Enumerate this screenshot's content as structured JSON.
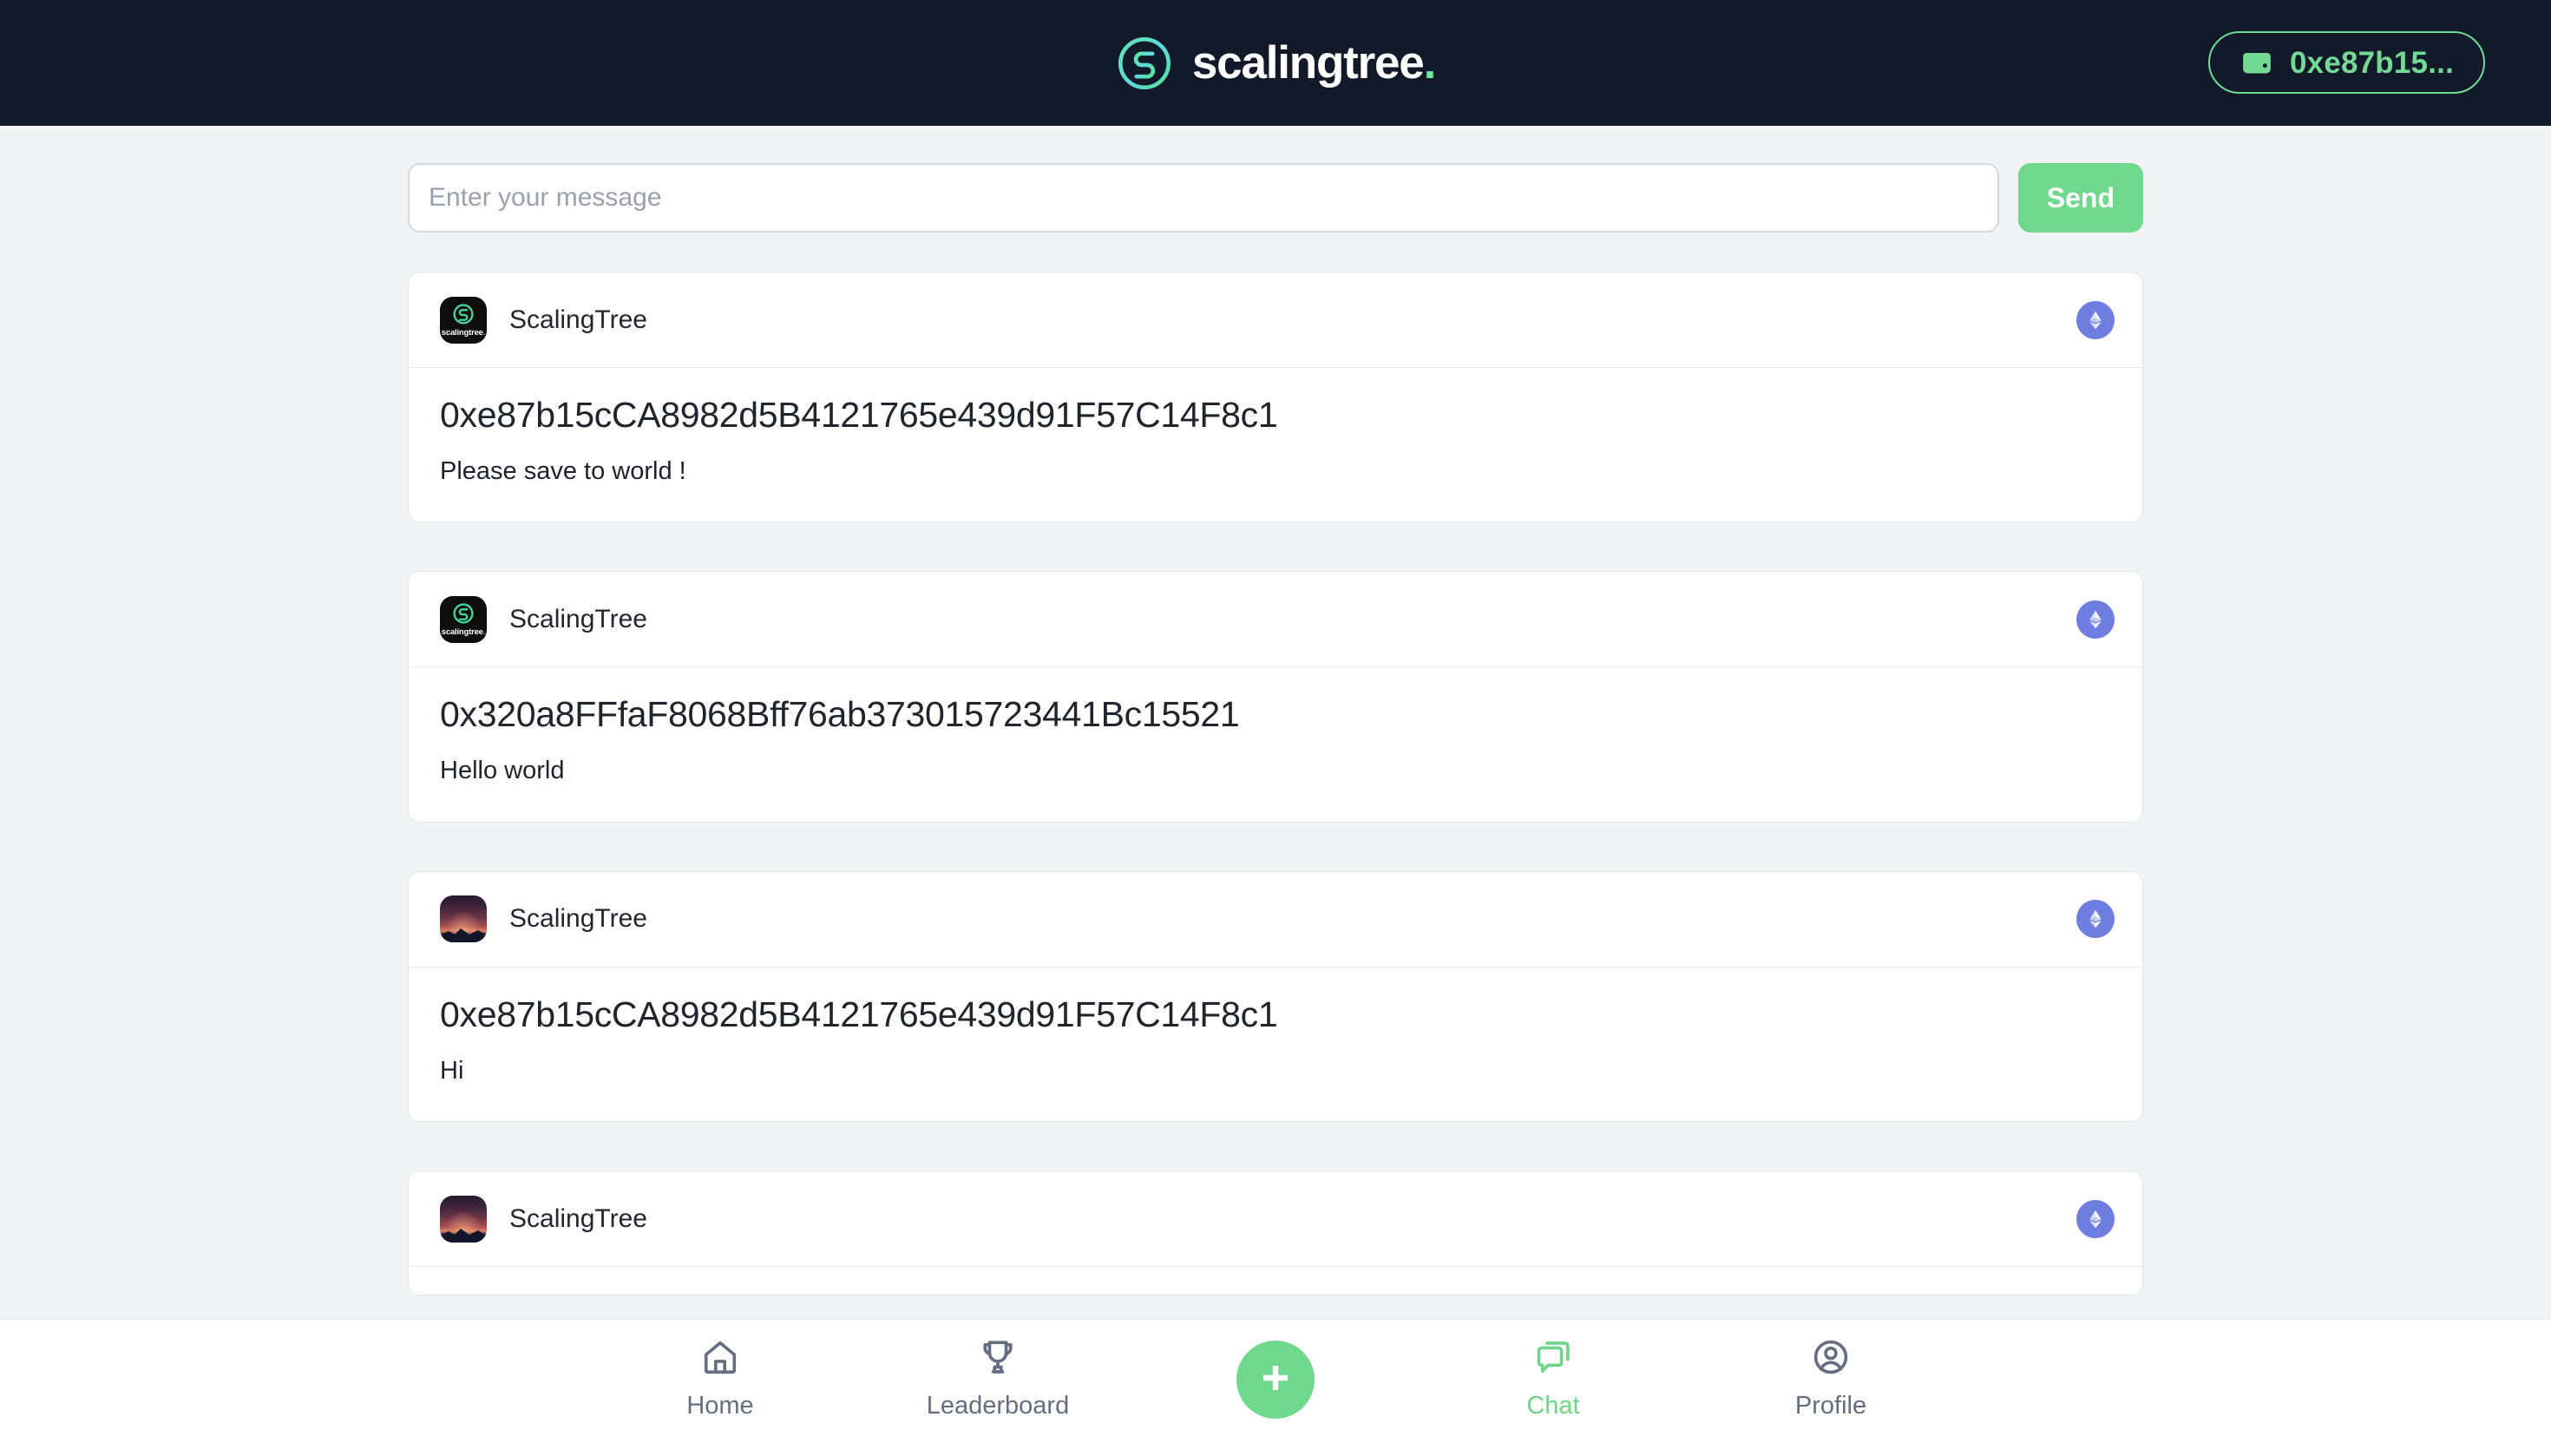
{
  "header": {
    "brand_name": "scalingtree",
    "brand_dot": ".",
    "logo_icon": "scalingtree-s-logo-icon",
    "wallet": {
      "icon": "wallet-icon",
      "label": "0xe87b15...",
      "accent": "#74d994"
    },
    "background": "#121a29"
  },
  "composer": {
    "input_value": "",
    "input_placeholder": "Enter your message",
    "send_label": "Send",
    "send_color": "#6fd88d"
  },
  "feed": {
    "messages": [
      {
        "sender": "ScalingTree",
        "avatar": "scalingtree-logo-avatar",
        "address": "0xe87b15cCA8982d5B4121765e439d91F57C14F8c1",
        "text": "Please save to world !",
        "chain_badge": "ethereum-icon",
        "partial": false
      },
      {
        "sender": "ScalingTree",
        "avatar": "scalingtree-logo-avatar",
        "address": "0x320a8FFfaF8068Bff76ab373015723441Bc15521",
        "text": "Hello world",
        "chain_badge": "ethereum-icon",
        "partial": false
      },
      {
        "sender": "ScalingTree",
        "avatar": "sunset-landscape-avatar",
        "address": "0xe87b15cCA8982d5B4121765e439d91F57C14F8c1",
        "text": "Hi",
        "chain_badge": "ethereum-icon",
        "partial": false
      },
      {
        "sender": "ScalingTree",
        "avatar": "sunset-landscape-avatar",
        "address": "",
        "text": "",
        "chain_badge": "ethereum-icon",
        "partial": true
      }
    ],
    "avatar_logo_text": "scalingtree",
    "avatar_logo_dot": "."
  },
  "bottom_nav": {
    "items": [
      {
        "label": "Home",
        "icon": "home-icon",
        "active": false
      },
      {
        "label": "Leaderboard",
        "icon": "trophy-icon",
        "active": false
      },
      {
        "label": "Chat",
        "icon": "chat-bubbles-icon",
        "active": true
      },
      {
        "label": "Profile",
        "icon": "person-circle-icon",
        "active": false
      }
    ],
    "fab": {
      "icon": "plus-icon",
      "color": "#6fd88d"
    },
    "inactive_color": "#646e80",
    "active_color": "#6ed48a"
  },
  "colors": {
    "page_background": "#f2f3f5",
    "card_background": "#ffffff",
    "accent_green": "#6fd88d",
    "ethereum_blue": "#6e7ee0"
  }
}
